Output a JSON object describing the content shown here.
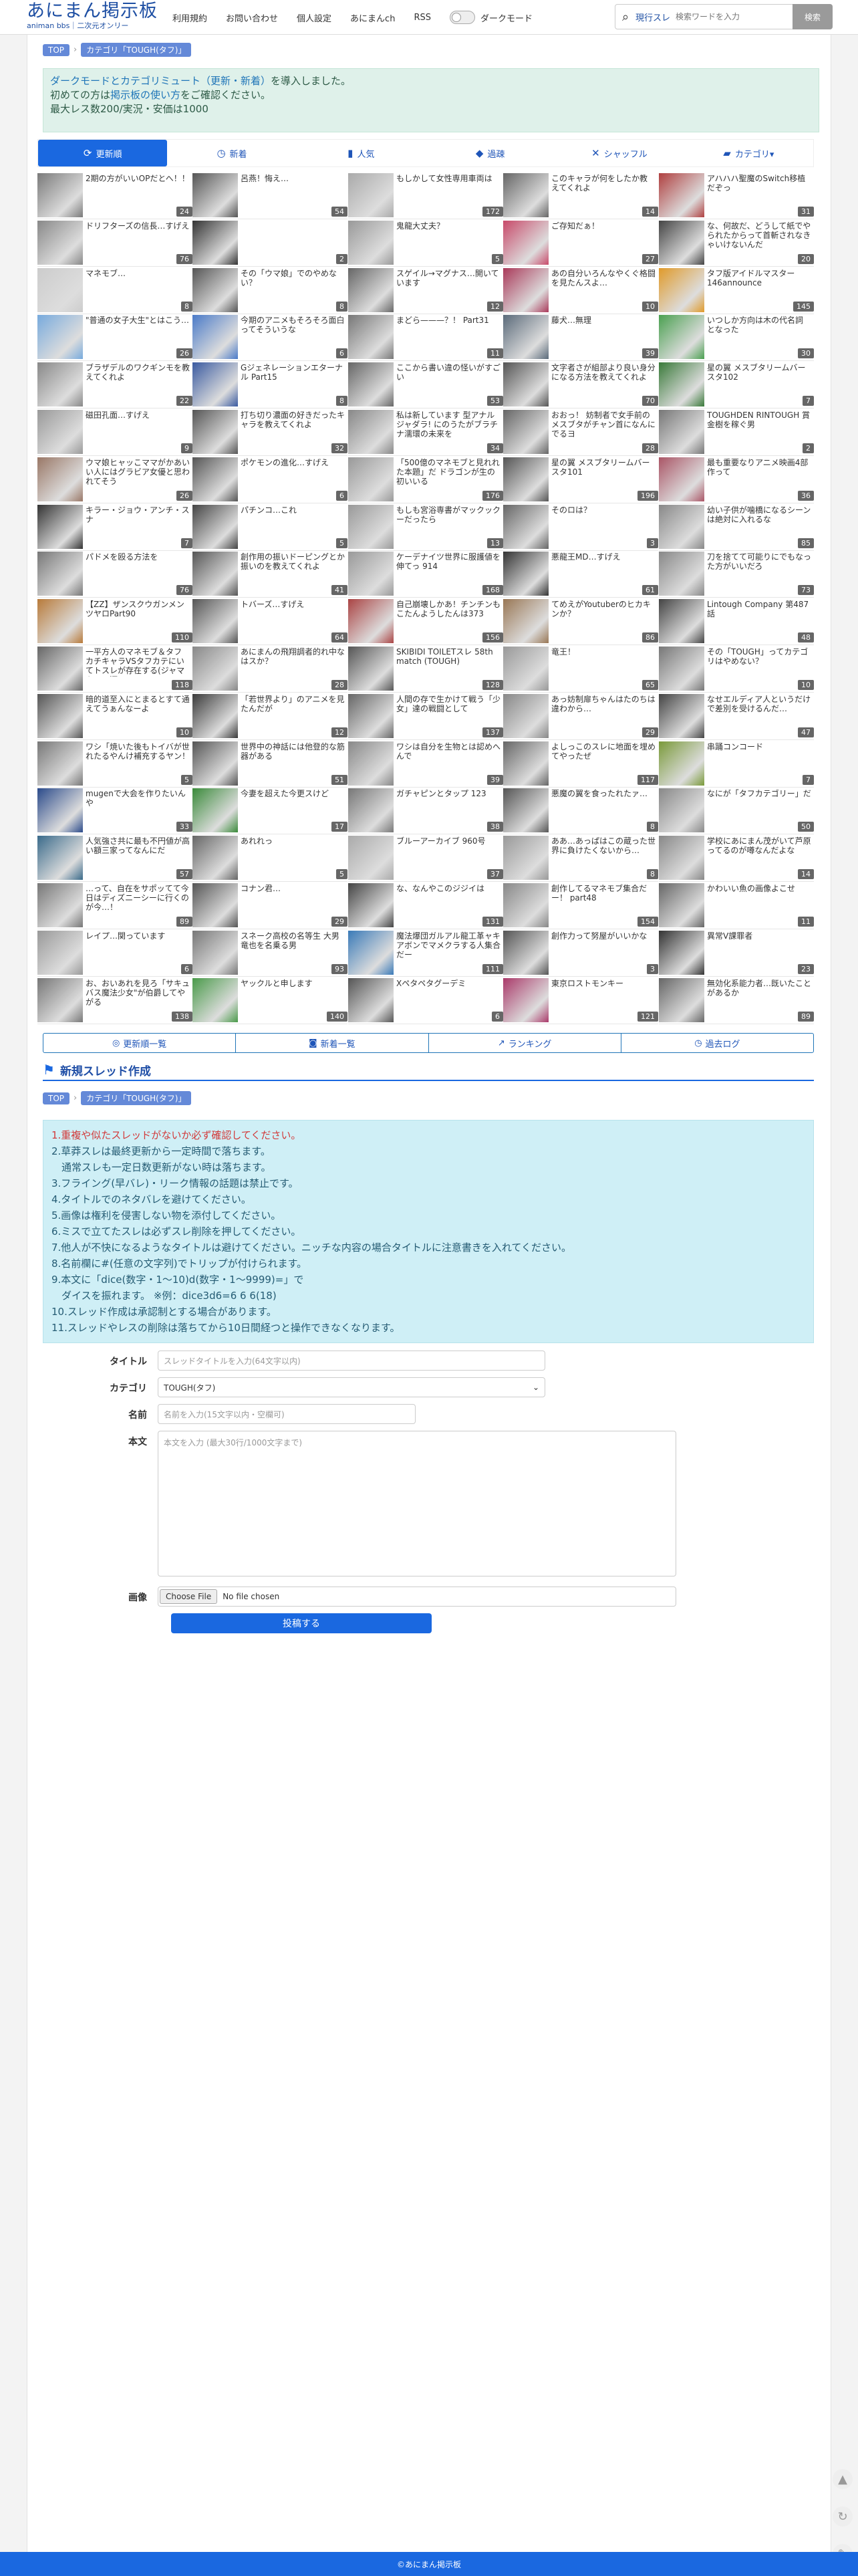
{
  "site": {
    "logo_main": "あにまん掲示板",
    "logo_sub": "animan bbs｜二次元オンリー"
  },
  "nav": [
    "利用規約",
    "お問い合わせ",
    "個人設定",
    "あにまんch",
    "RSS"
  ],
  "dark_mode_label": "ダークモード",
  "search": {
    "scope_label": "現行スレ",
    "placeholder": "検索ワードを入力",
    "button": "検索"
  },
  "breadcrumb": {
    "top": "TOP",
    "category": "カテゴリ「TOUGH(タフ)」"
  },
  "notice": {
    "line1_link": "ダークモードとカテゴリミュート（更新・新着）",
    "line1_rest": "を導入しました。",
    "line2_pre": "初めての方は",
    "line2_link": "掲示板の使い方",
    "line2_post": "をご確認ください。",
    "line3": "最大レス数200/実況・安価は1000"
  },
  "tabs": [
    {
      "icon": "⟳",
      "label": "更新順"
    },
    {
      "icon": "◷",
      "label": "新着"
    },
    {
      "icon": "▮",
      "label": "人気"
    },
    {
      "icon": "◆",
      "label": "過疎"
    },
    {
      "icon": "✕",
      "label": "シャッフル"
    },
    {
      "icon": "▰",
      "label": "カテゴリ▾"
    }
  ],
  "threads": [
    {
      "t": "2期の方がいいOPだとへ！！",
      "c": "24",
      "col": "#7a7a7a"
    },
    {
      "t": "呂燕！悔え…",
      "c": "54",
      "col": "#555"
    },
    {
      "t": "もしかして女性専用車両は",
      "c": "172",
      "col": "#aaa"
    },
    {
      "t": "このキャラが何をしたか教えてくれよ",
      "c": "14",
      "col": "#666"
    },
    {
      "t": "アハハハ聖魔のSwitch移植だぞっ",
      "c": "31",
      "col": "#b04040"
    },
    {
      "t": "ドリフターズの信長…すげえ",
      "c": "76",
      "col": "#888"
    },
    {
      "t": "",
      "c": "2",
      "col": "#333"
    },
    {
      "t": "鬼龍大丈夫？",
      "c": "5",
      "col": "#999"
    },
    {
      "t": "ご存知だぁ！",
      "c": "27",
      "col": "#c84a6a"
    },
    {
      "t": "な、何故だ、どうして紙でやられたからって首斬されなきゃいけないんだ",
      "c": "20",
      "col": "#444"
    },
    {
      "t": "マネモブ…",
      "c": "8",
      "col": "#ccc"
    },
    {
      "t": "その「ウマ娘」でのやめない？",
      "c": "8",
      "col": "#555"
    },
    {
      "t": "スゲイル→マグナス…開いています",
      "c": "12",
      "col": "#666"
    },
    {
      "t": "あの自分いろんなやくぐ格闘を見たんスよ…",
      "c": "10",
      "col": "#aa3a5a"
    },
    {
      "t": "タフ版アイドルマスター 146announce",
      "c": "145",
      "col": "#e09a2a"
    },
    {
      "t": "\"普通の女子大生\"とはこう…",
      "c": "26",
      "col": "#77aadd"
    },
    {
      "t": "今期のアニメもそろそろ面白ってそういうな",
      "c": "6",
      "col": "#4a7ac8"
    },
    {
      "t": "まどら———？！ Part31",
      "c": "11",
      "col": "#777"
    },
    {
      "t": "藤犬…無理",
      "c": "39",
      "col": "#5a6a7a"
    },
    {
      "t": "いつしか方向は木の代名詞となった",
      "c": "30",
      "col": "#4aa050"
    },
    {
      "t": "ブラザデルのワクギンモを教えてくれよ",
      "c": "22",
      "col": "#888"
    },
    {
      "t": "Gジェネレーションエターナル Part15",
      "c": "8",
      "col": "#3a5aa0"
    },
    {
      "t": "ここから書い違の怪いがすごい",
      "c": "53",
      "col": "#666"
    },
    {
      "t": "文字者さが組部より良い身分になる方法を教えてくれよ",
      "c": "70",
      "col": "#555"
    },
    {
      "t": "星の翼 メスブタリームバースタ102",
      "c": "7",
      "col": "#3a7a3a"
    },
    {
      "t": "磁田孔面…すげえ",
      "c": "9",
      "col": "#999"
    },
    {
      "t": "打ち切り濃面の好きだったキャラを教えてくれよ",
      "c": "32",
      "col": "#555"
    },
    {
      "t": "私は新しています 型アナルジャダラ! にのうたがブラチナ濡環の未来を",
      "c": "34",
      "col": "#888"
    },
    {
      "t": "おおっ！ 妨制者で女手前のメスブタがチャン首になんにでるヨ",
      "c": "28",
      "col": "#666"
    },
    {
      "t": "TOUGHDEN RINTOUGH 賞金樹を稼ぐ男",
      "c": "2",
      "col": "#777"
    },
    {
      "t": "ウマ娘ヒャッこママがかあいい人にはグラビア女優と思われてそう",
      "c": "26",
      "col": "#997766"
    },
    {
      "t": "ポケモンの進化…すげえ",
      "c": "6",
      "col": "#555"
    },
    {
      "t": "「500億のマネモブと見れれた本題」だ ドラゴンが生の初いいる",
      "c": "176",
      "col": "#999"
    },
    {
      "t": "星の翼 メスブタリームバースタ101",
      "c": "196",
      "col": "#555"
    },
    {
      "t": "最も重要なりアニメ映画4部作って",
      "c": "36",
      "col": "#aa5566"
    },
    {
      "t": "キラー・ジョウ・アンチ・スナ",
      "c": "7",
      "col": "#333"
    },
    {
      "t": "パチンコ…これ",
      "c": "5",
      "col": "#444"
    },
    {
      "t": "もしも宮浴専書がマックックーだったら",
      "c": "13",
      "col": "#999"
    },
    {
      "t": "そのロは？",
      "c": "3",
      "col": "#666"
    },
    {
      "t": "幼い子供が噛橋になるシーンは絶対に入れるな",
      "c": "85",
      "col": "#888"
    },
    {
      "t": "パドメを殴る方法を",
      "c": "76",
      "col": "#777"
    },
    {
      "t": "創作用の振いドーピングとか振いのを教えてくれよ",
      "c": "41",
      "col": "#555"
    },
    {
      "t": "ケーデナイツ世界に服護値を伸てっ 914",
      "c": "168",
      "col": "#999"
    },
    {
      "t": "悪龍王MD…すげえ",
      "c": "61",
      "col": "#333"
    },
    {
      "t": "刀を捨てて可能りにでもなった方がいいだろ",
      "c": "73",
      "col": "#888"
    },
    {
      "t": "【ZZ】ザンスクウガンメンツヤロPart90",
      "c": "110",
      "col": "#b87a3a"
    },
    {
      "t": "トバーズ…すげえ",
      "c": "64",
      "col": "#555"
    },
    {
      "t": "自己崩壊しかあ！チンチンもこたんようしたんは373",
      "c": "156",
      "col": "#aa4444"
    },
    {
      "t": "てめえがYoutuberのヒカキンか？",
      "c": "86",
      "col": "#997755"
    },
    {
      "t": "Lintough Company 第487話",
      "c": "48",
      "col": "#444"
    },
    {
      "t": "一平方人のマネモブ＆タフ カチキャラVSタフカテにいてトスレが存在する(ジャマキャラ源",
      "c": "118",
      "col": "#666"
    },
    {
      "t": "あにまんの飛翔調者的れ中なはスか？",
      "c": "28",
      "col": "#888"
    },
    {
      "t": "SKIBIDI TOILETスレ 58th match (TOUGH)",
      "c": "128",
      "col": "#555"
    },
    {
      "t": "竜王！",
      "c": "65",
      "col": "#999"
    },
    {
      "t": "その「TOUGH」ってカテゴリはやめない？",
      "c": "10",
      "col": "#777"
    },
    {
      "t": "暗的道至入にとまるとすて通えてうぁんなーよ",
      "c": "10",
      "col": "#555"
    },
    {
      "t": "「若世界より」のアニメを見たんだが",
      "c": "12",
      "col": "#3a3a3a"
    },
    {
      "t": "人間の存で生かけて戦う「少女」達の戦闘として",
      "c": "137",
      "col": "#666"
    },
    {
      "t": "あっ妨制扉ちゃんはたのちは違わから…",
      "c": "29",
      "col": "#888"
    },
    {
      "t": "なせエルディア人というだけで差別を受けるんだ…",
      "c": "47",
      "col": "#444"
    },
    {
      "t": "ワシ「焼いた後もトイバが世れたるやんけ補充するヤン！",
      "c": "5",
      "col": "#777"
    },
    {
      "t": "世界中の神話には他登的な筋器がある",
      "c": "51",
      "col": "#555"
    },
    {
      "t": "ワシは自分を生物とは認めへんで",
      "c": "39",
      "col": "#888"
    },
    {
      "t": "よしっこのスレに地面を埋めてやったぜ",
      "c": "117",
      "col": "#666"
    },
    {
      "t": "串踊コンコード",
      "c": "7",
      "col": "#7a9a3a"
    },
    {
      "t": "mugenで大会を作りたいんや",
      "c": "33",
      "col": "#2a4a8a"
    },
    {
      "t": "今妻を超えた今更スけど",
      "c": "17",
      "col": "#3a8a3a"
    },
    {
      "t": "ガチャピンとタップ 123",
      "c": "38",
      "col": "#777"
    },
    {
      "t": "悪魔の翼を食ったれたァ…",
      "c": "8",
      "col": "#555"
    },
    {
      "t": "なにが「タフカテゴリー」だ",
      "c": "50",
      "col": "#888"
    },
    {
      "t": "人気強さ共に最も不円値が高い額三家ってなんにだ",
      "c": "57",
      "col": "#3a6a8a"
    },
    {
      "t": "あれれっ",
      "c": "5",
      "col": "#666"
    },
    {
      "t": "ブルーアーカイブ 960号",
      "c": "37",
      "col": "#aaa"
    },
    {
      "t": "ああ…あっぱはこの蔵った世界に負けたくないから…",
      "c": "8",
      "col": "#999"
    },
    {
      "t": "学校にあにまん茂がいて芦原ってるのが噂なんだよな",
      "c": "14",
      "col": "#888"
    },
    {
      "t": "…って、自在をサポッてて今日はディズニーシーに行くのが今…！",
      "c": "89",
      "col": "#777"
    },
    {
      "t": "コナン君…",
      "c": "29",
      "col": "#555"
    },
    {
      "t": "な、なんやこのジジイは",
      "c": "131",
      "col": "#444"
    },
    {
      "t": "創作してるマネモブ集合だー！ part48",
      "c": "154",
      "col": "#888"
    },
    {
      "t": "かわいい魚の画像よこせ",
      "c": "11",
      "col": "#666"
    },
    {
      "t": "レイプ…関っています",
      "c": "6",
      "col": "#999"
    },
    {
      "t": "スネーク高校の名等生 大男竜也を名乗る男",
      "c": "93",
      "col": "#777"
    },
    {
      "t": "魔法爆団ガルアル龍工革ャキアボンでマメクラする人集合だー",
      "c": "111",
      "col": "#3a7ab8"
    },
    {
      "t": "創作力って努屋がいいかな",
      "c": "3",
      "col": "#555"
    },
    {
      "t": "異常V課罪者",
      "c": "23",
      "col": "#333"
    },
    {
      "t": "お、おいあれを見ろ「サキュバス魔法少女\"が伯爵してやがる",
      "c": "138",
      "col": "#777"
    },
    {
      "t": "ヤックルと申します",
      "c": "140",
      "col": "#4a9a4a"
    },
    {
      "t": "Xペタペタグーデミ",
      "c": "6",
      "col": "#555"
    },
    {
      "t": "東京ロストモンキー",
      "c": "121",
      "col": "#aa3a6a"
    },
    {
      "t": "無効化系能力者…既いたことがあるか",
      "c": "89",
      "col": "#666"
    }
  ],
  "bottom_nav": [
    {
      "icon": "◎",
      "label": "更新順一覧"
    },
    {
      "icon": "◙",
      "label": "新着一覧"
    },
    {
      "icon": "↗",
      "label": "ランキング"
    },
    {
      "icon": "◷",
      "label": "過去ログ"
    }
  ],
  "new_thread": {
    "heading": "新規スレッド作成",
    "breadcrumb_top": "TOP",
    "breadcrumb_cat": "カテゴリ「TOUGH(タフ)」"
  },
  "rules": [
    "1.重複や似たスレッドがないか必ず確認してください。",
    "2.草莽スレは最終更新から一定時間で落ちます。",
    "　通常スレも一定日数更新がない時は落ちます。",
    "3.フライング(早バレ)・リーク情報の話題は禁止です。",
    "4.タイトルでのネタバレを避けてください。",
    "5.画像は権利を侵害しない物を添付してください。",
    "6.ミスで立てたスレは必ずスレ削除を押してください。",
    "7.他人が不快になるようなタイトルは避けてください。ニッチな内容の場合タイトルに注意書きを入れてください。",
    "8.名前欄に#(任意の文字列)でトリップが付けられます。",
    "9.本文に「dice(数字・1〜10)d(数字・1〜9999)=」で",
    "　ダイスを振れます。 ※例：dice3d6=6 6 6(18)",
    "10.スレッド作成は承認制とする場合があります。",
    "11.スレッドやレスの削除は落ちてから10日間経つと操作できなくなります。"
  ],
  "form": {
    "title_label": "タイトル",
    "title_ph": "スレッドタイトルを入力(64文字以内)",
    "cat_label": "カテゴリ",
    "cat_value": "TOUGH(タフ)",
    "name_label": "名前",
    "name_ph": "名前を入力(15文字以内・空欄可)",
    "body_label": "本文",
    "body_ph": "本文を入力 (最大30行/1000文字まで)",
    "image_label": "画像",
    "file_button": "Choose File",
    "file_status": "No file chosen",
    "submit": "投稿する"
  },
  "footer": "©あにまん掲示板"
}
